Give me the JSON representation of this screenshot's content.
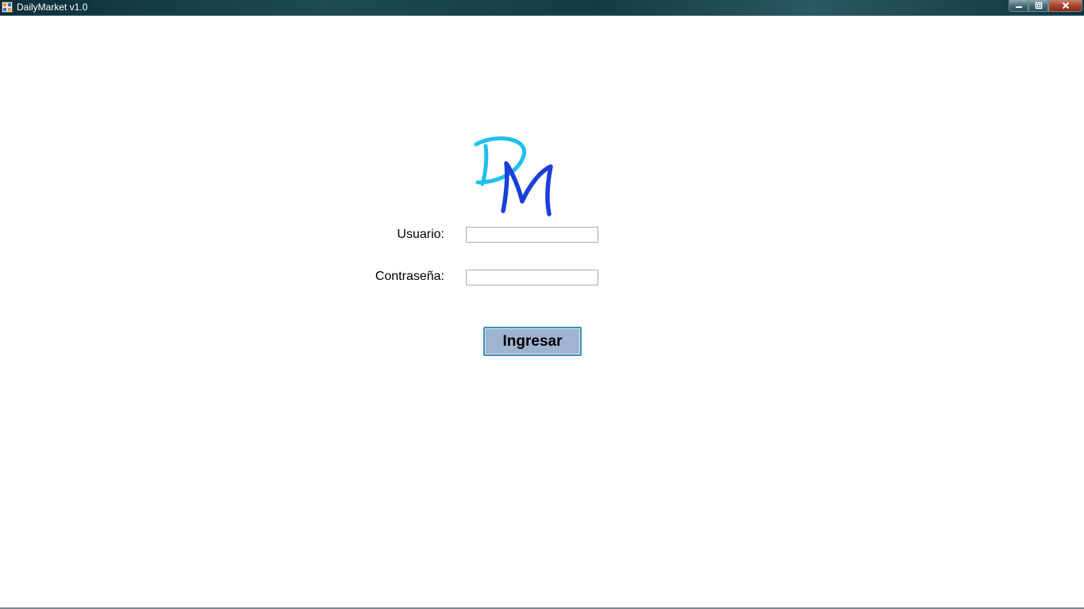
{
  "window": {
    "title": "DailyMarket v1.0",
    "controls": {
      "minimize_icon": "minimize-icon",
      "restore_icon": "restore-icon",
      "close_icon": "close-icon"
    }
  },
  "logo": {
    "letter_1": "D",
    "letter_2": "M",
    "color_1": "#1ec0f0",
    "color_2": "#1a3fdc"
  },
  "form": {
    "username_label": "Usuario:",
    "username_value": "",
    "password_label": "Contraseña:",
    "password_value": "",
    "submit_label": "Ingresar"
  },
  "colors": {
    "button_fill": "#9fb4d0",
    "button_border": "#3b91b6"
  }
}
